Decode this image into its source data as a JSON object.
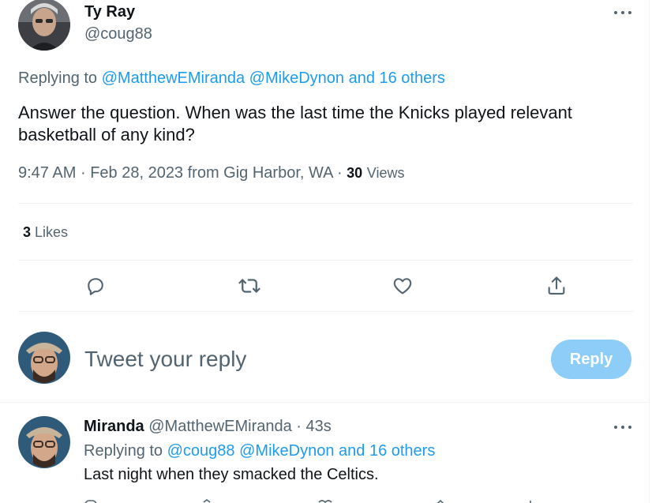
{
  "tweet": {
    "author_name": "Ty Ray",
    "author_handle": "@coug88",
    "replying_prefix": "Replying to",
    "replying_mention1": "@MatthewEMiranda",
    "replying_mention2": "@MikeDynon",
    "replying_others": "and 16 others",
    "text_line1": "Answer the question. When was the last time the Knicks played relevant",
    "text_line2": "basketball of any kind?",
    "time": "9:47 AM",
    "date": "Feb 28, 2023",
    "location": "from Gig Harbor, WA",
    "views_count": "30",
    "views_label": "Views",
    "likes_count": "3",
    "likes_label": "Likes"
  },
  "composer": {
    "placeholder": "Tweet your reply",
    "reply_label": "Reply"
  },
  "reply": {
    "author_name": "Miranda",
    "author_handle": "@MatthewEMiranda",
    "time_ago": "43s",
    "replying_prefix": "Replying to",
    "replying_mention1": "@coug88",
    "replying_mention2": "@MikeDynon",
    "replying_others": "and 16 others",
    "text": "Last night when they smacked the Celtics."
  },
  "colors": {
    "accent": "#1d9bf0",
    "reply_button_disabled": "#8ecdf8",
    "secondary_text": "#536471",
    "divider": "#eff3f4"
  },
  "icons": [
    "more-icon",
    "comment-icon",
    "retweet-icon",
    "like-icon",
    "share-icon"
  ]
}
